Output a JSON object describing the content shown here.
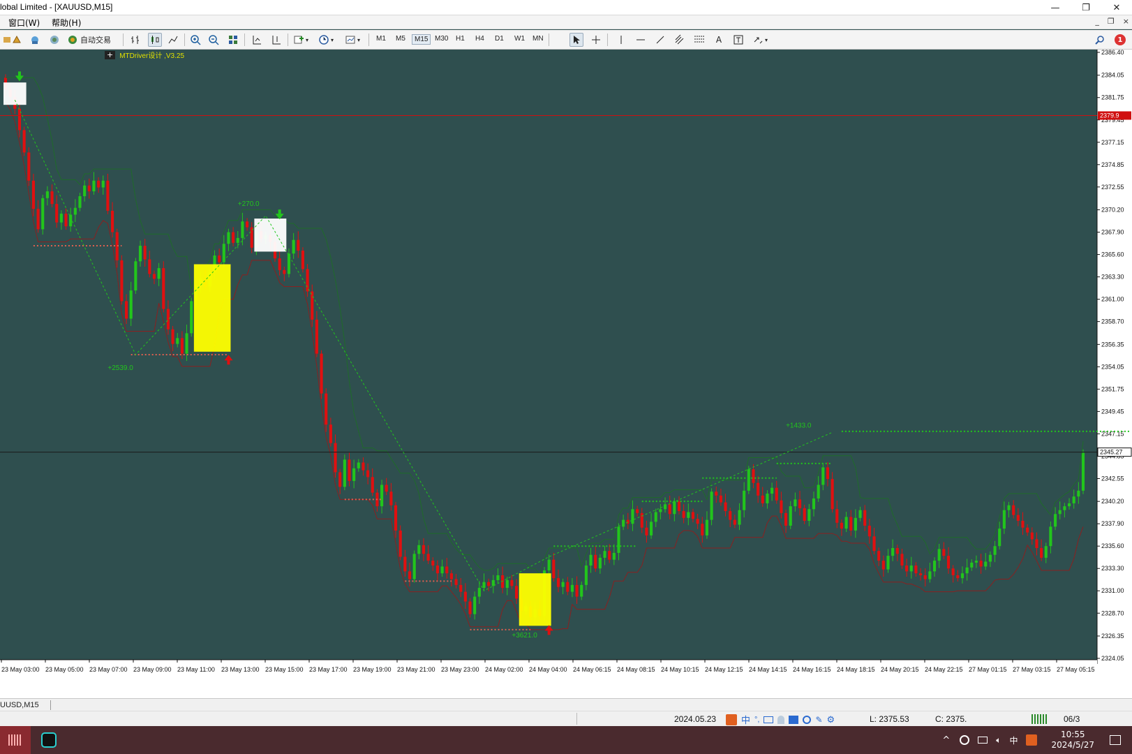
{
  "window": {
    "title": "lobal Limited - [XAUUSD,M15]",
    "buttons": [
      "—",
      "❐",
      "✕"
    ]
  },
  "menu": {
    "items": [
      "窗口(W)",
      "帮助(H)"
    ],
    "mdi_buttons": [
      "_",
      "❐",
      "×"
    ]
  },
  "toolbar": {
    "autotrade_label": "自动交易",
    "timeframes": [
      "M1",
      "M5",
      "M15",
      "M30",
      "H1",
      "H4",
      "D1",
      "W1",
      "MN"
    ],
    "active_timeframe": "M15",
    "notification_count": "1",
    "line_text_label": "A"
  },
  "chart": {
    "indicator_label": "MTDriver设计 ,V3.25",
    "indicator_prefix": "+",
    "current_price_label": "2345.27",
    "red_line_label": "2379.9",
    "background_color": "#2f4f4f",
    "bull_color": "#22c51c",
    "bear_color": "#e01010",
    "annotations": [
      "+270.0",
      "+2539.0",
      "+1433.0",
      "+3621.0"
    ]
  },
  "chart_data": {
    "type": "candlestick",
    "symbol": "XAUUSD",
    "timeframe": "M15",
    "y_ticks": [
      2386.4,
      2384.05,
      2381.75,
      2379.45,
      2377.15,
      2374.85,
      2372.55,
      2370.2,
      2367.9,
      2365.6,
      2363.3,
      2361.0,
      2358.7,
      2356.35,
      2354.05,
      2351.75,
      2349.45,
      2347.15,
      2344.85,
      2342.55,
      2340.2,
      2337.9,
      2335.6,
      2333.3,
      2331.0,
      2328.7,
      2326.35,
      2324.05
    ],
    "ylim": [
      2324.05,
      2386.4
    ],
    "x_ticks": [
      "23 May 03:00",
      "23 May 05:00",
      "23 May 07:00",
      "23 May 09:00",
      "23 May 11:00",
      "23 May 13:00",
      "23 May 15:00",
      "23 May 17:00",
      "23 May 19:00",
      "23 May 21:00",
      "23 May 23:00",
      "24 May 02:00",
      "24 May 04:00",
      "24 May 06:15",
      "24 May 08:15",
      "24 May 10:15",
      "24 May 12:15",
      "24 May 14:15",
      "24 May 16:15",
      "24 May 18:15",
      "24 May 20:15",
      "24 May 22:15",
      "27 May 01:15",
      "27 May 03:15",
      "27 May 05:15"
    ],
    "red_hline": 2379.9,
    "current_price": 2345.27,
    "signals": [
      {
        "label": "+270.0",
        "type": "sell",
        "price": 2369.6
      },
      {
        "label": "+2539.0",
        "type": "buy",
        "price": 2355.0
      },
      {
        "label": "+3621.0",
        "type": "buy",
        "price": 2327.3
      },
      {
        "label": "+1433.0",
        "type": "sell",
        "price": 2347.1
      }
    ],
    "closes": [
      2382.6,
      2381.8,
      2380.6,
      2378.4,
      2376.1,
      2373.2,
      2370.3,
      2368.2,
      2371.4,
      2372.1,
      2370.8,
      2368.9,
      2369.8,
      2368.5,
      2369.7,
      2370.4,
      2371.6,
      2372.7,
      2372.1,
      2373.2,
      2372.5,
      2373.2,
      2370.1,
      2367.9,
      2365.0,
      2360.8,
      2359.0,
      2361.9,
      2364.9,
      2366.5,
      2365.1,
      2363.6,
      2363.1,
      2364.2,
      2360.0,
      2357.9,
      2356.4,
      2357.0,
      2355.4,
      2357.5,
      2360.8,
      2362.4,
      2363.1,
      2362.3,
      2363.8,
      2365.5,
      2364.8,
      2366.7,
      2367.9,
      2366.8,
      2367.3,
      2369.0,
      2368.4,
      2366.3,
      2368.0,
      2367.2,
      2367.6,
      2366.9,
      2365.2,
      2364.0,
      2363.6,
      2365.7,
      2367.1,
      2366.0,
      2364.1,
      2361.8,
      2358.9,
      2355.4,
      2351.3,
      2348.1,
      2346.2,
      2343.2,
      2341.7,
      2344.5,
      2342.3,
      2343.6,
      2344.2,
      2343.4,
      2342.7,
      2341.1,
      2339.7,
      2341.9,
      2341.2,
      2339.8,
      2337.2,
      2334.5,
      2333.0,
      2332.2,
      2334.8,
      2335.7,
      2334.8,
      2334.1,
      2333.6,
      2332.8,
      2333.5,
      2332.8,
      2332.2,
      2331.6,
      2330.9,
      2329.9,
      2328.6,
      2330.4,
      2331.3,
      2331.9,
      2331.5,
      2332.1,
      2332.6,
      2331.3,
      2332.1,
      2331.5,
      2330.2,
      2328.9,
      2329.4,
      2328.3,
      2329.1,
      2328.4,
      2333.1,
      2334.2,
      2332.3,
      2331.4,
      2331.9,
      2330.9,
      2331.6,
      2330.4,
      2331.6,
      2333.6,
      2334.7,
      2333.3,
      2334.4,
      2335.1,
      2334.2,
      2334.9,
      2337.6,
      2338.3,
      2337.9,
      2339.4,
      2339.0,
      2337.5,
      2336.7,
      2338.1,
      2339.1,
      2339.4,
      2339.9,
      2338.9,
      2340.2,
      2339.2,
      2338.5,
      2339.1,
      2338.4,
      2337.9,
      2336.7,
      2338.3,
      2341.2,
      2340.8,
      2340.1,
      2339.2,
      2338.3,
      2337.8,
      2339.3,
      2341.3,
      2343.5,
      2342.1,
      2340.8,
      2340.0,
      2341.0,
      2341.6,
      2340.3,
      2339.0,
      2337.7,
      2339.7,
      2340.4,
      2339.5,
      2338.2,
      2339.4,
      2340.5,
      2341.9,
      2343.7,
      2342.5,
      2339.4,
      2338.0,
      2337.4,
      2338.6,
      2337.2,
      2338.5,
      2339.3,
      2337.7,
      2336.6,
      2335.1,
      2334.1,
      2333.2,
      2334.6,
      2335.4,
      2334.8,
      2333.6,
      2333.0,
      2333.6,
      2332.8,
      2332.6,
      2332.2,
      2333.0,
      2334.1,
      2335.3,
      2334.6,
      2333.3,
      2332.6,
      2332.3,
      2332.8,
      2333.4,
      2333.9,
      2334.1,
      2333.5,
      2334.0,
      2334.7,
      2335.6,
      2337.4,
      2339.3,
      2339.8,
      2338.8,
      2338.2,
      2337.5,
      2337.0,
      2336.3,
      2335.4,
      2334.4,
      2335.6,
      2337.6,
      2338.9,
      2339.3,
      2339.7,
      2340.0,
      2340.7,
      2341.3,
      2345.2
    ]
  },
  "statusbar": {
    "left_text": "UUSD,M15",
    "date": "2024.05.23",
    "low": "L: 2375.53",
    "close": "C: 2375.",
    "tail": "06/3"
  },
  "taskbar": {
    "time": "10:55",
    "date": "2024/5/27",
    "ime": "中"
  }
}
